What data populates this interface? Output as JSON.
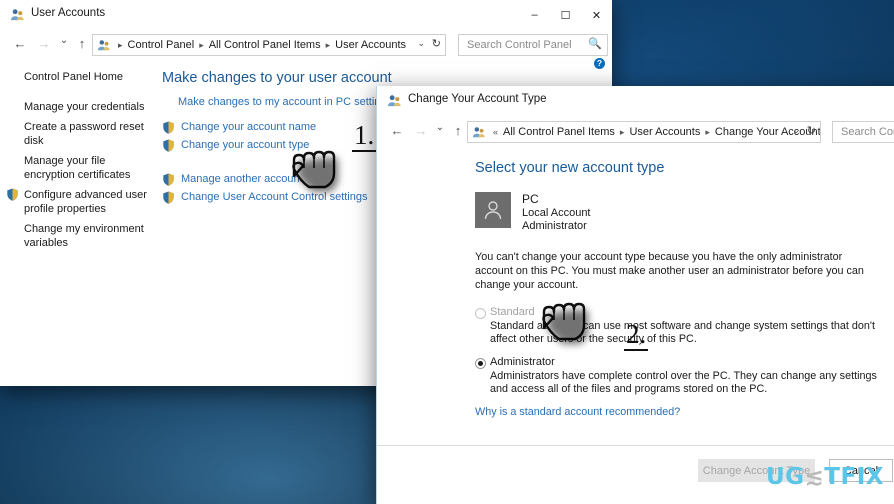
{
  "desktop": {
    "background_color": "#0a3156"
  },
  "window1": {
    "title": "User Accounts",
    "title_icon": "user-accounts-icon",
    "controls": {
      "minimize": "–",
      "maximize": "☐",
      "close": "✕"
    },
    "nav": {
      "back": "←",
      "forward": "→",
      "recent": "⌄",
      "up": "↑",
      "dropdown": "⌄",
      "refresh": "↻"
    },
    "breadcrumb": [
      "Control Panel",
      "All Control Panel Items",
      "User Accounts"
    ],
    "search": {
      "placeholder": "Search Control Panel",
      "icon": "search-icon"
    },
    "help_icon": "help-question-icon",
    "sidebar": {
      "home": "Control Panel Home",
      "items": [
        {
          "label": "Manage your credentials",
          "shield": false
        },
        {
          "label": "Create a password reset disk",
          "shield": false
        },
        {
          "label": "Manage your file encryption certificates",
          "shield": false
        },
        {
          "label": "Configure advanced user profile properties",
          "shield": true
        },
        {
          "label": "Change my environment variables",
          "shield": false
        }
      ]
    },
    "content": {
      "heading": "Make changes to your user account",
      "pc_settings_link": "Make changes to my account in PC settings",
      "links_group1": [
        {
          "label": "Change your account name",
          "shield": true
        },
        {
          "label": "Change your account type",
          "shield": true
        }
      ],
      "links_group2": [
        {
          "label": "Manage another account",
          "shield": true
        },
        {
          "label": "Change User Account Control settings",
          "shield": true
        }
      ]
    }
  },
  "window2": {
    "title": "Change Your Account Type",
    "title_icon": "user-accounts-icon",
    "nav": {
      "back": "←",
      "forward": "→",
      "recent": "⌄",
      "up": "↑",
      "overflow": "«",
      "dropdown": "⌄",
      "refresh": "↻"
    },
    "breadcrumb": [
      "All Control Panel Items",
      "User Accounts",
      "Change Your Account Type"
    ],
    "search": {
      "placeholder": "Search Control P",
      "icon": "search-icon"
    },
    "heading": "Select your new account type",
    "account": {
      "avatar_icon": "user-avatar-icon",
      "name": "PC",
      "type": "Local Account",
      "role": "Administrator"
    },
    "warning": "You can't change your account type because you have the only administrator account on this PC. You must make another user an administrator before you can change your account.",
    "options": [
      {
        "label": "Standard",
        "selected": false,
        "disabled": true,
        "description": "Standard accounts can use most software and change system settings that don't affect other users or the security of this PC."
      },
      {
        "label": "Administrator",
        "selected": true,
        "disabled": false,
        "description": "Administrators have complete control over the PC. They can change any settings and access all of the files and programs stored on the PC."
      }
    ],
    "why_link": "Why is a standard account recommended?",
    "buttons": {
      "primary": "Change Account Type",
      "cancel": "Cancel"
    }
  },
  "annotations": [
    {
      "id": "step-1",
      "label": "1."
    },
    {
      "id": "step-2",
      "label": "2."
    }
  ],
  "cursors": [
    {
      "id": "hand-cursor-1",
      "icon": "pointing-hand-cursor"
    },
    {
      "id": "hand-cursor-2",
      "icon": "pointing-hand-cursor"
    }
  ],
  "watermark": {
    "part1": "UG",
    "part2": "≲",
    "part3": "TFIX",
    "color1": "#5cc6e8",
    "color2": "#b9b9b9"
  }
}
